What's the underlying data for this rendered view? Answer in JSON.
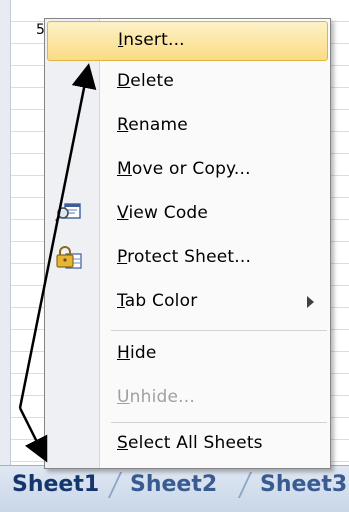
{
  "sheet": {
    "cell_value": "5"
  },
  "context_menu": {
    "items": [
      {
        "pre": "",
        "underline": "I",
        "post": "nsert...",
        "enabled": true
      },
      {
        "pre": "",
        "underline": "D",
        "post": "elete",
        "enabled": true
      },
      {
        "pre": "",
        "underline": "R",
        "post": "ename",
        "enabled": true
      },
      {
        "pre": "",
        "underline": "M",
        "post": "ove or Copy...",
        "enabled": true
      },
      {
        "pre": "",
        "underline": "V",
        "post": "iew Code",
        "enabled": true,
        "icon": "view-code-icon"
      },
      {
        "pre": "",
        "underline": "P",
        "post": "rotect Sheet...",
        "enabled": true,
        "icon": "protect-sheet-icon"
      },
      {
        "pre": "",
        "underline": "T",
        "post": "ab Color",
        "enabled": true,
        "submenu": true
      },
      {
        "pre": "",
        "underline": "H",
        "post": "ide",
        "enabled": true
      },
      {
        "pre": "",
        "underline": "U",
        "post": "nhide...",
        "enabled": false
      },
      {
        "pre": "",
        "underline": "S",
        "post": "elect All Sheets",
        "enabled": true
      }
    ]
  },
  "sheet_tabs": [
    "Sheet1",
    "Sheet2",
    "Sheet3"
  ],
  "colors": {
    "highlight": "#fbdc85",
    "tab_text": "#1d3c75",
    "disabled_text": "#a0a0a0"
  }
}
